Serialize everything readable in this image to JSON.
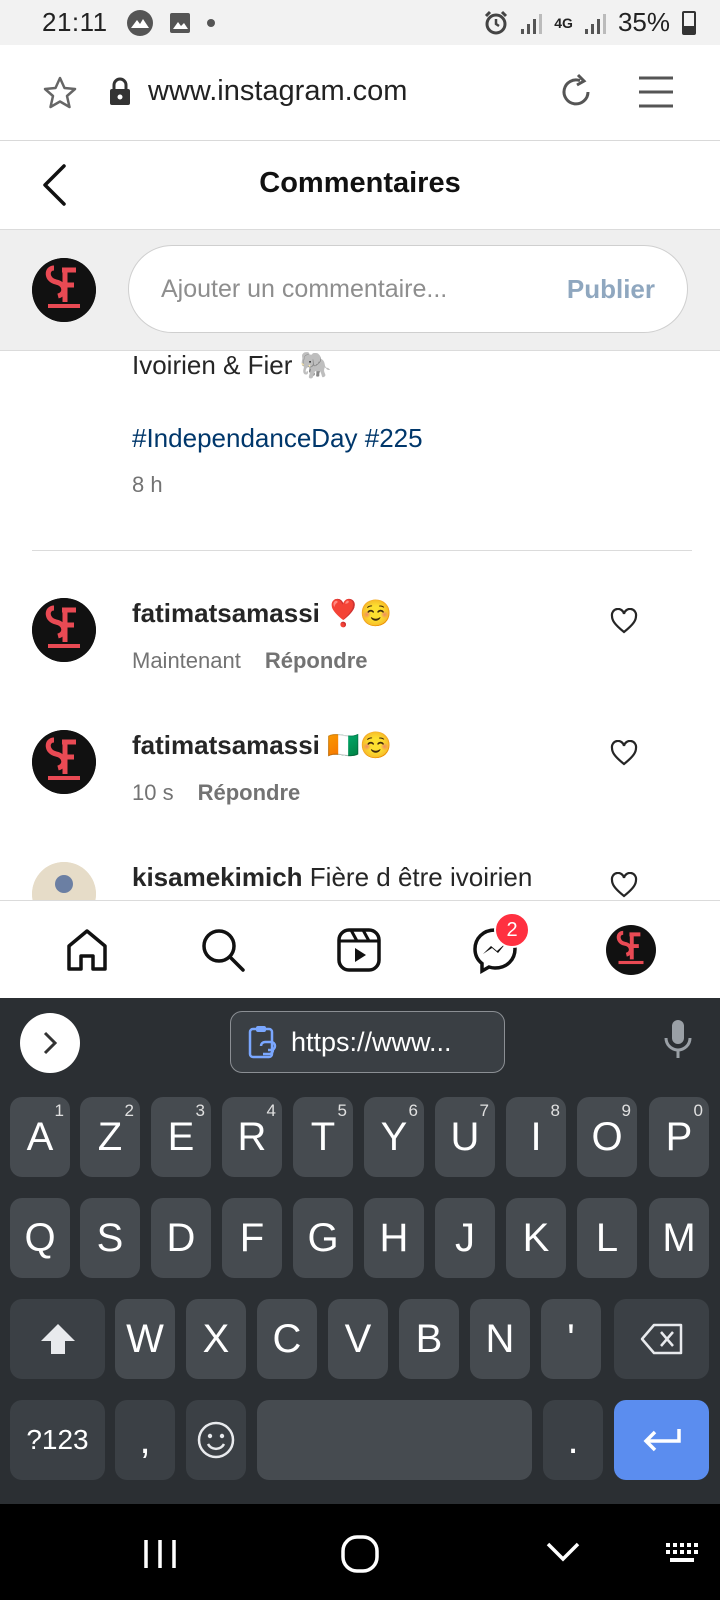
{
  "status_bar": {
    "time": "21:11",
    "network": "4G",
    "battery": "35%"
  },
  "browser": {
    "url": "www.instagram.com"
  },
  "header": {
    "title": "Commentaires"
  },
  "composer": {
    "placeholder": "Ajouter un commentaire...",
    "publish_label": "Publier"
  },
  "caption": {
    "text": "Ivoirien & Fier 🐘",
    "hashtags": "#IndependanceDay #225",
    "time": "8 h"
  },
  "comments": [
    {
      "username": "fatimatsamassi",
      "text": "❣️☺️",
      "time": "Maintenant",
      "reply_label": "Répondre"
    },
    {
      "username": "fatimatsamassi",
      "text": "🇨🇮☺️",
      "time": "10 s",
      "reply_label": "Répondre"
    },
    {
      "username": "kisamekimich",
      "text": "Fière d être ivoirien"
    }
  ],
  "bottom_nav": {
    "messages_badge": "2"
  },
  "keyboard": {
    "clipboard_text": "https://www...",
    "row1": [
      "A",
      "Z",
      "E",
      "R",
      "T",
      "Y",
      "U",
      "I",
      "O",
      "P"
    ],
    "row1_hints": [
      "1",
      "2",
      "3",
      "4",
      "5",
      "6",
      "7",
      "8",
      "9",
      "0"
    ],
    "row2": [
      "Q",
      "S",
      "D",
      "F",
      "G",
      "H",
      "J",
      "K",
      "L",
      "M"
    ],
    "row3": [
      "W",
      "X",
      "C",
      "V",
      "B",
      "N",
      "'"
    ],
    "symbols_label": "?123",
    "comma": ",",
    "period": "."
  },
  "colors": {
    "link": "#00376b",
    "publish_disabled": "#8fa7bf",
    "badge": "#ff3040",
    "enter_key": "#5b8def",
    "keyboard_bg": "#2b2f33"
  }
}
